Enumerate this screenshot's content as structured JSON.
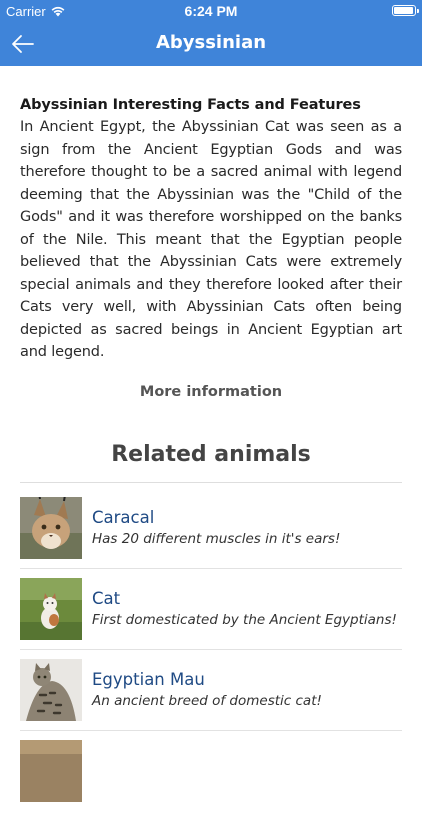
{
  "status_bar": {
    "carrier": "Carrier",
    "time": "6:24 PM"
  },
  "nav": {
    "title": "Abyssinian",
    "back_icon": "arrow-left-icon"
  },
  "article": {
    "heading": "Abyssinian Interesting Facts and Features",
    "body": "In Ancient Egypt, the Abyssinian Cat was seen as a sign from the Ancient Egyptian Gods and was therefore thought to be a sacred animal with legend deeming that the Abyssinian was the \"Child of the Gods\" and it was therefore worshipped on the banks of the Nile. This meant that the Egyptian people believed that the Abyssinian Cats were extremely special animals and they therefore looked after their Cats very well, with Abyssinian Cats often being depicted as sacred beings in Ancient Egyptian art and legend."
  },
  "more_info_label": "More information",
  "related": {
    "title": "Related animals",
    "items": [
      {
        "name": "Caracal",
        "description": "Has 20 different muscles in it's ears!"
      },
      {
        "name": "Cat",
        "description": "First domesticated by the Ancient Egyptians!"
      },
      {
        "name": "Egyptian Mau",
        "description": "An ancient breed of domestic cat!"
      }
    ]
  },
  "colors": {
    "accent": "#3f84d9",
    "link": "#1f4a84"
  }
}
